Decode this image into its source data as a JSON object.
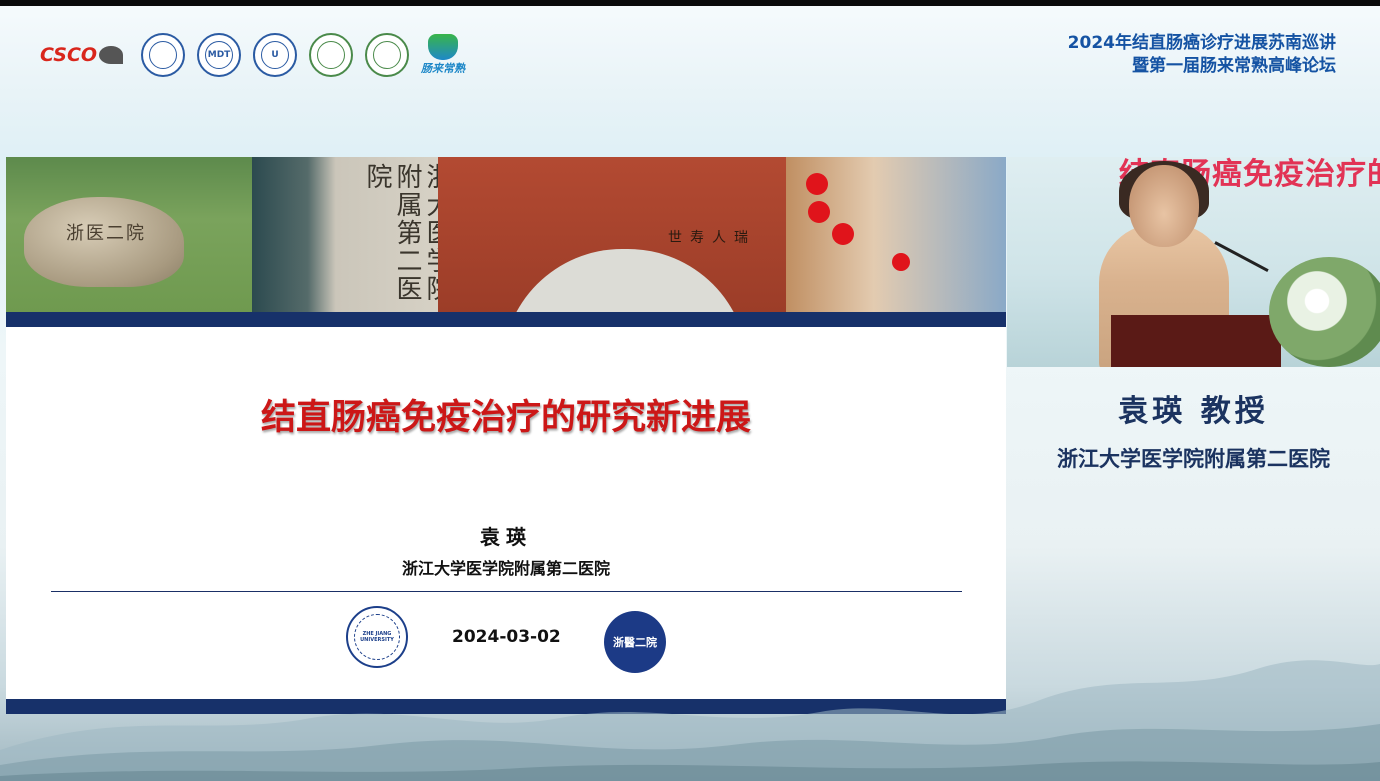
{
  "header": {
    "conference_line1": "2024年结直肠癌诊疗进展苏南巡讲",
    "conference_line2": "暨第一届肠来常熟高峰论坛",
    "logos": {
      "csco": "CSCO",
      "seal_1": "",
      "seal_2": "MDT",
      "seal_3": "U",
      "seal_4": "",
      "seal_5": "",
      "brand_caption": "肠来常熟"
    }
  },
  "slide": {
    "photo_rock_text": "浙医二院",
    "photo_building_text": "浙大医学院附属第二医院",
    "photo_gate_text": "世寿人瑞",
    "title": "结直肠癌免疫治疗的研究新进展",
    "speaker": "袁瑛",
    "affiliation": "浙江大学医学院附属第二医院",
    "date": "2024-03-02",
    "zju_seal_text": "ZHE JIANG UNIVERSITY",
    "hospital_seal_text": "浙醫二院"
  },
  "video": {
    "screen_text": "结直肠癌免疫治疗的"
  },
  "speaker_panel": {
    "name_title": "袁瑛 教授",
    "hospital": "浙江大学医学院附属第二医院"
  }
}
